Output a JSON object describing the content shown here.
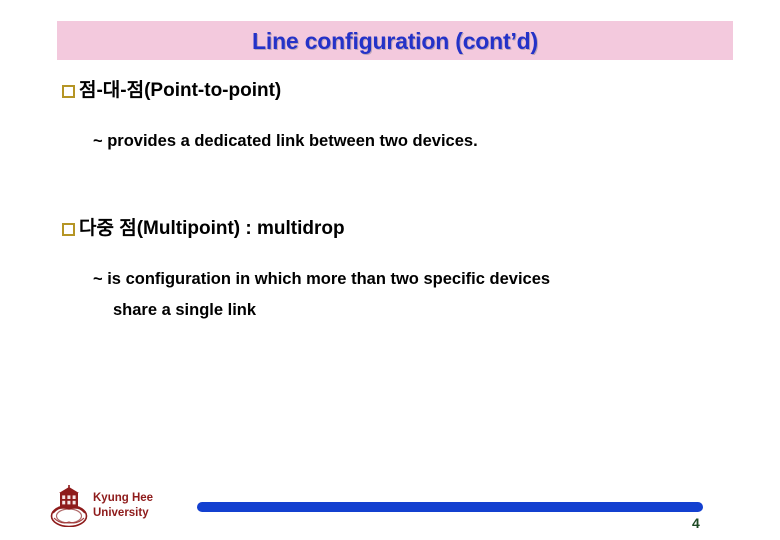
{
  "slide": {
    "title": "Line configuration (cont’d)",
    "title_band_color": "#f3c9dd",
    "title_text_color": "#2432c8",
    "bullet_marker_color": "#b59525",
    "content": [
      {
        "bullet": "점-대-점(Point-to-point)",
        "lines": [
          "~ provides a dedicated link between two devices."
        ]
      },
      {
        "bullet": "다중 점(Multipoint) : multidrop",
        "lines": [
          "~ is configuration in which more than two specific devices",
          "share a single link"
        ]
      }
    ]
  },
  "footer": {
    "university_line1": "Kyung Hee",
    "university_line2": "University",
    "university_color": "#8e1b1b",
    "progress_bar_color": "#1340d0",
    "page_number": "4",
    "page_number_color": "#1d4a24"
  }
}
